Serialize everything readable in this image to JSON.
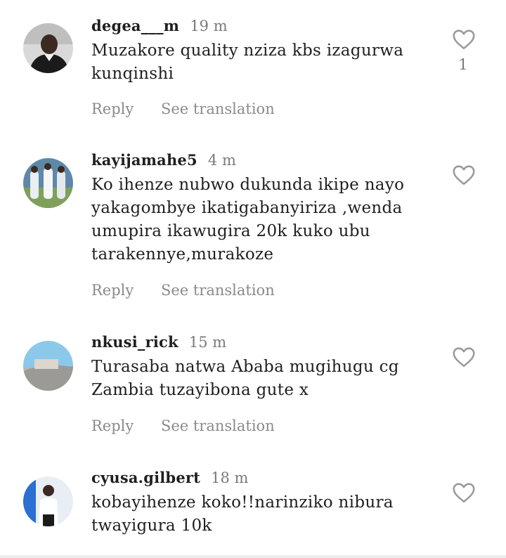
{
  "comments": [
    {
      "username": "degea___m",
      "time": "19 m",
      "text": "Muzakore quality nziza kbs izagurwa kunqinshi",
      "reply_label": "Reply",
      "translate_label": "See translation",
      "like_icon": "heart-outline-icon",
      "like_count": "1"
    },
    {
      "username": "kayijamahe5",
      "time": "4 m",
      "text": "Ko ihenze nubwo dukunda ikipe nayo yakagombye ikatigabanyiriza ,wenda umupira ikawugira 20k kuko ubu tarakennye,murakoze",
      "reply_label": "Reply",
      "translate_label": "See translation",
      "like_icon": "heart-outline-icon"
    },
    {
      "username": "nkusi_rick",
      "time": "15 m",
      "text": "Turasaba natwa Ababa mugihugu cg Zambia tuzayibona gute x",
      "reply_label": "Reply",
      "translate_label": "See translation",
      "like_icon": "heart-outline-icon"
    },
    {
      "username": "cyusa.gilbert",
      "time": "18 m",
      "text": "kobayihenze koko!!narinziko nibura twayigura 10k",
      "like_icon": "heart-outline-icon"
    }
  ],
  "colors": {
    "text": "#1f1f1f",
    "muted": "#8a8a8a",
    "heart": "#9a9a9a"
  }
}
